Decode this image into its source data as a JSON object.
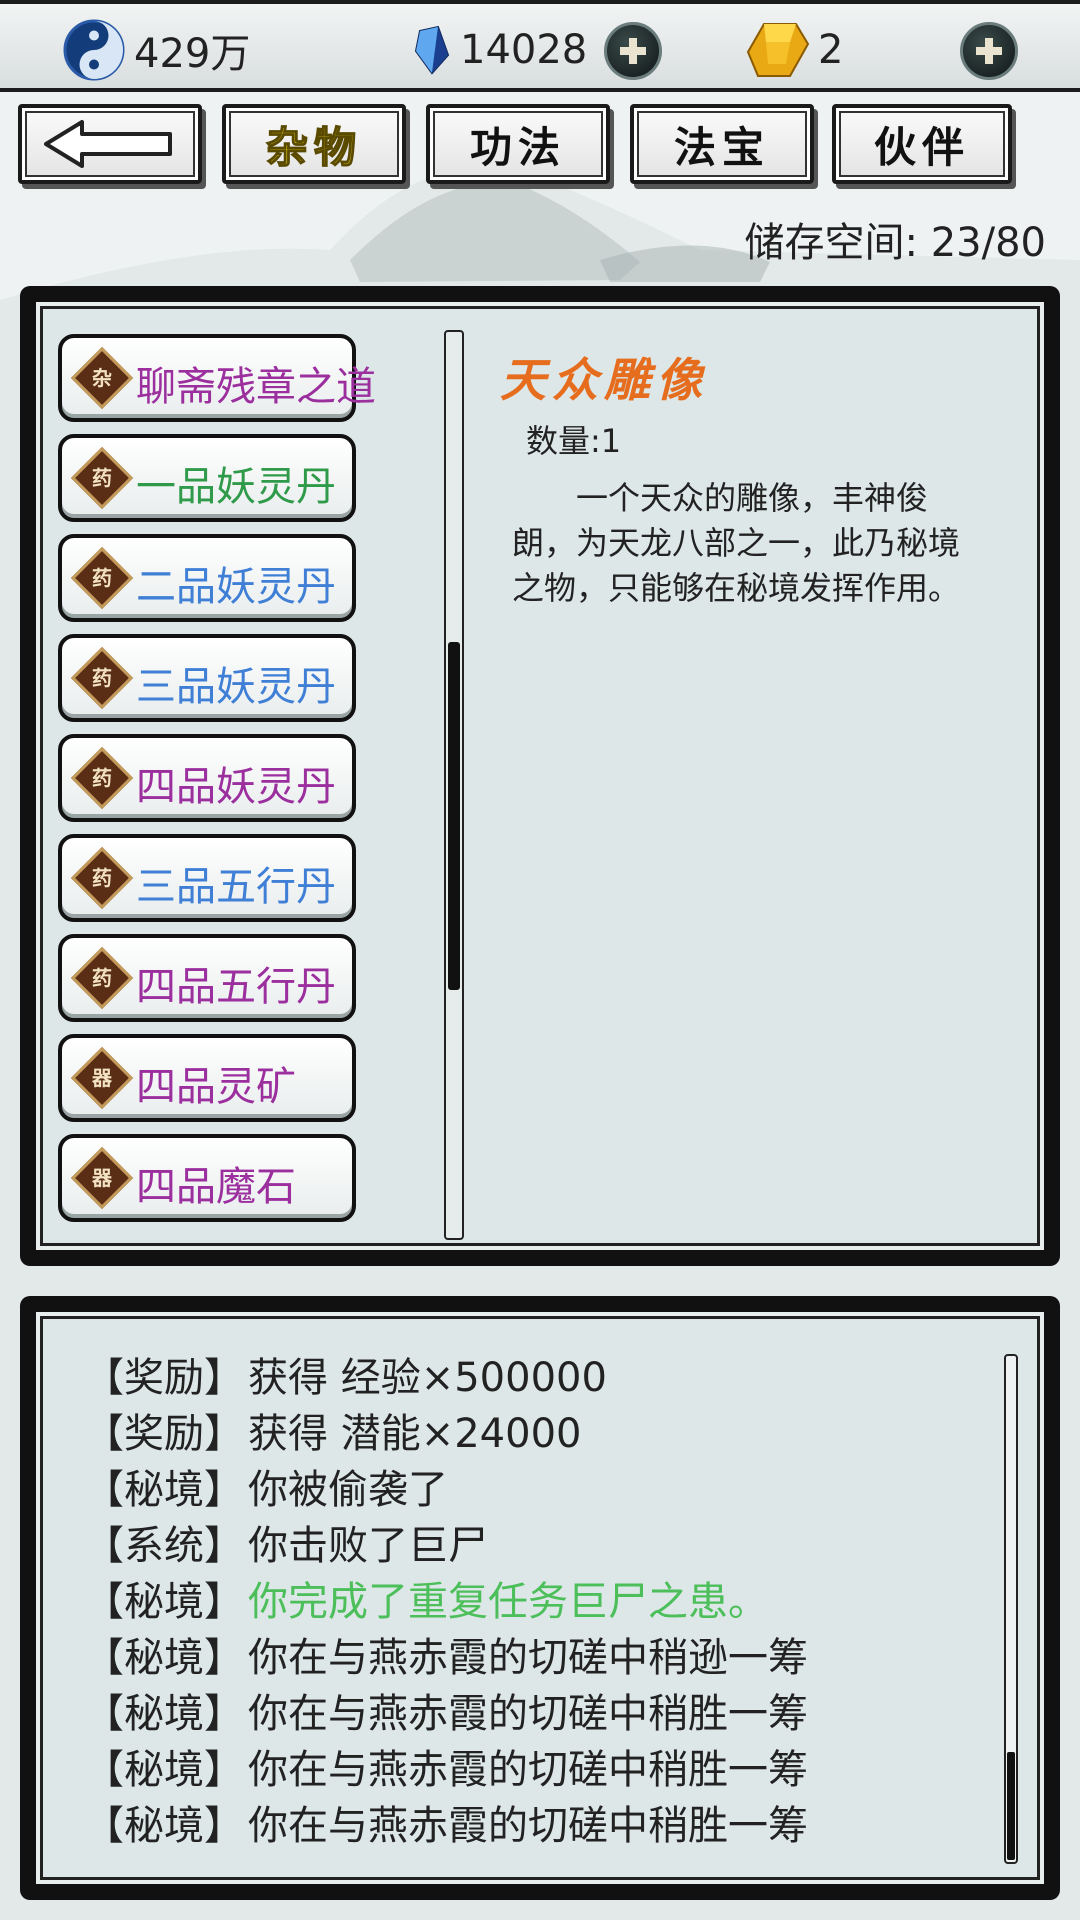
{
  "resources": {
    "silver": {
      "icon": "yin-yang-icon",
      "value": "429万"
    },
    "spirit_stone": {
      "icon": "blue-crystal-icon",
      "value": "14028"
    },
    "gold_gem": {
      "icon": "gold-gem-icon",
      "value": "2"
    }
  },
  "tabs": [
    {
      "label": "杂物",
      "active": true
    },
    {
      "label": "功法",
      "active": false
    },
    {
      "label": "法宝",
      "active": false
    },
    {
      "label": "伙伴",
      "active": false
    }
  ],
  "storage": "储存空间: 23/80",
  "items": [
    {
      "badge": "杂",
      "name": "聊斋残章之道",
      "color": "#9b2f9e"
    },
    {
      "badge": "药",
      "name": "一品妖灵丹",
      "color": "#2f9b4a"
    },
    {
      "badge": "药",
      "name": "二品妖灵丹",
      "color": "#3f7fd6"
    },
    {
      "badge": "药",
      "name": "三品妖灵丹",
      "color": "#3f7fd6"
    },
    {
      "badge": "药",
      "name": "四品妖灵丹",
      "color": "#9b2f9e"
    },
    {
      "badge": "药",
      "name": "三品五行丹",
      "color": "#3f7fd6"
    },
    {
      "badge": "药",
      "name": "四品五行丹",
      "color": "#9b2f9e"
    },
    {
      "badge": "器",
      "name": "四品灵矿",
      "color": "#9b2f9e"
    },
    {
      "badge": "器",
      "name": "四品魔石",
      "color": "#9b2f9e"
    }
  ],
  "detail": {
    "title": "天众雕像",
    "quantity": "数量:1",
    "description": "一个天众的雕像，丰神俊朗，为天龙八部之一，此乃秘境之物，只能够在秘境发挥作用。"
  },
  "log": [
    {
      "tag": "【奖励】",
      "text": "获得 经验×500000",
      "color": "#222222"
    },
    {
      "tag": "【奖励】",
      "text": "获得 潜能×24000",
      "color": "#222222"
    },
    {
      "tag": "【秘境】",
      "text": "你被偷袭了",
      "color": "#222222"
    },
    {
      "tag": "【系统】",
      "text": "你击败了巨尸",
      "color": "#222222"
    },
    {
      "tag": "【秘境】",
      "text": "你完成了重复任务巨尸之患。",
      "color": "#4cbf5a"
    },
    {
      "tag": "【秘境】",
      "text": "你在与燕赤霞的切磋中稍逊一筹",
      "color": "#222222"
    },
    {
      "tag": "【秘境】",
      "text": "你在与燕赤霞的切磋中稍胜一筹",
      "color": "#222222"
    },
    {
      "tag": "【秘境】",
      "text": "你在与燕赤霞的切磋中稍胜一筹",
      "color": "#222222"
    },
    {
      "tag": "【秘境】",
      "text": "你在与燕赤霞的切磋中稍胜一筹",
      "color": "#222222"
    }
  ]
}
